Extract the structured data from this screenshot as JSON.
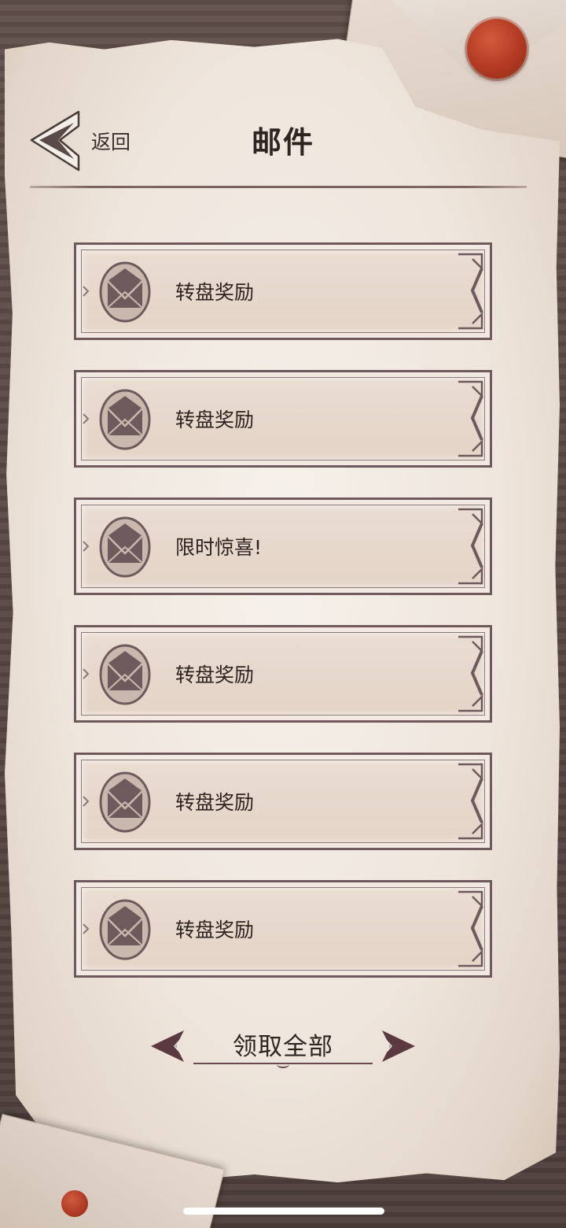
{
  "header": {
    "back_label": "返回",
    "title": "邮件"
  },
  "mails": [
    {
      "title": "转盘奖励"
    },
    {
      "title": "转盘奖励"
    },
    {
      "title": "限时惊喜!"
    },
    {
      "title": "转盘奖励"
    },
    {
      "title": "转盘奖励"
    },
    {
      "title": "转盘奖励"
    }
  ],
  "actions": {
    "claim_all_label": "领取全部"
  },
  "colors": {
    "frame": "#6e5a5c",
    "icon": "#6e5a5c",
    "text": "#2c2321",
    "parchment": "#f3ece4",
    "wax_seal": "#b23a22"
  },
  "icons": {
    "back": "back-triangle-icon",
    "mail": "envelope-icon"
  }
}
